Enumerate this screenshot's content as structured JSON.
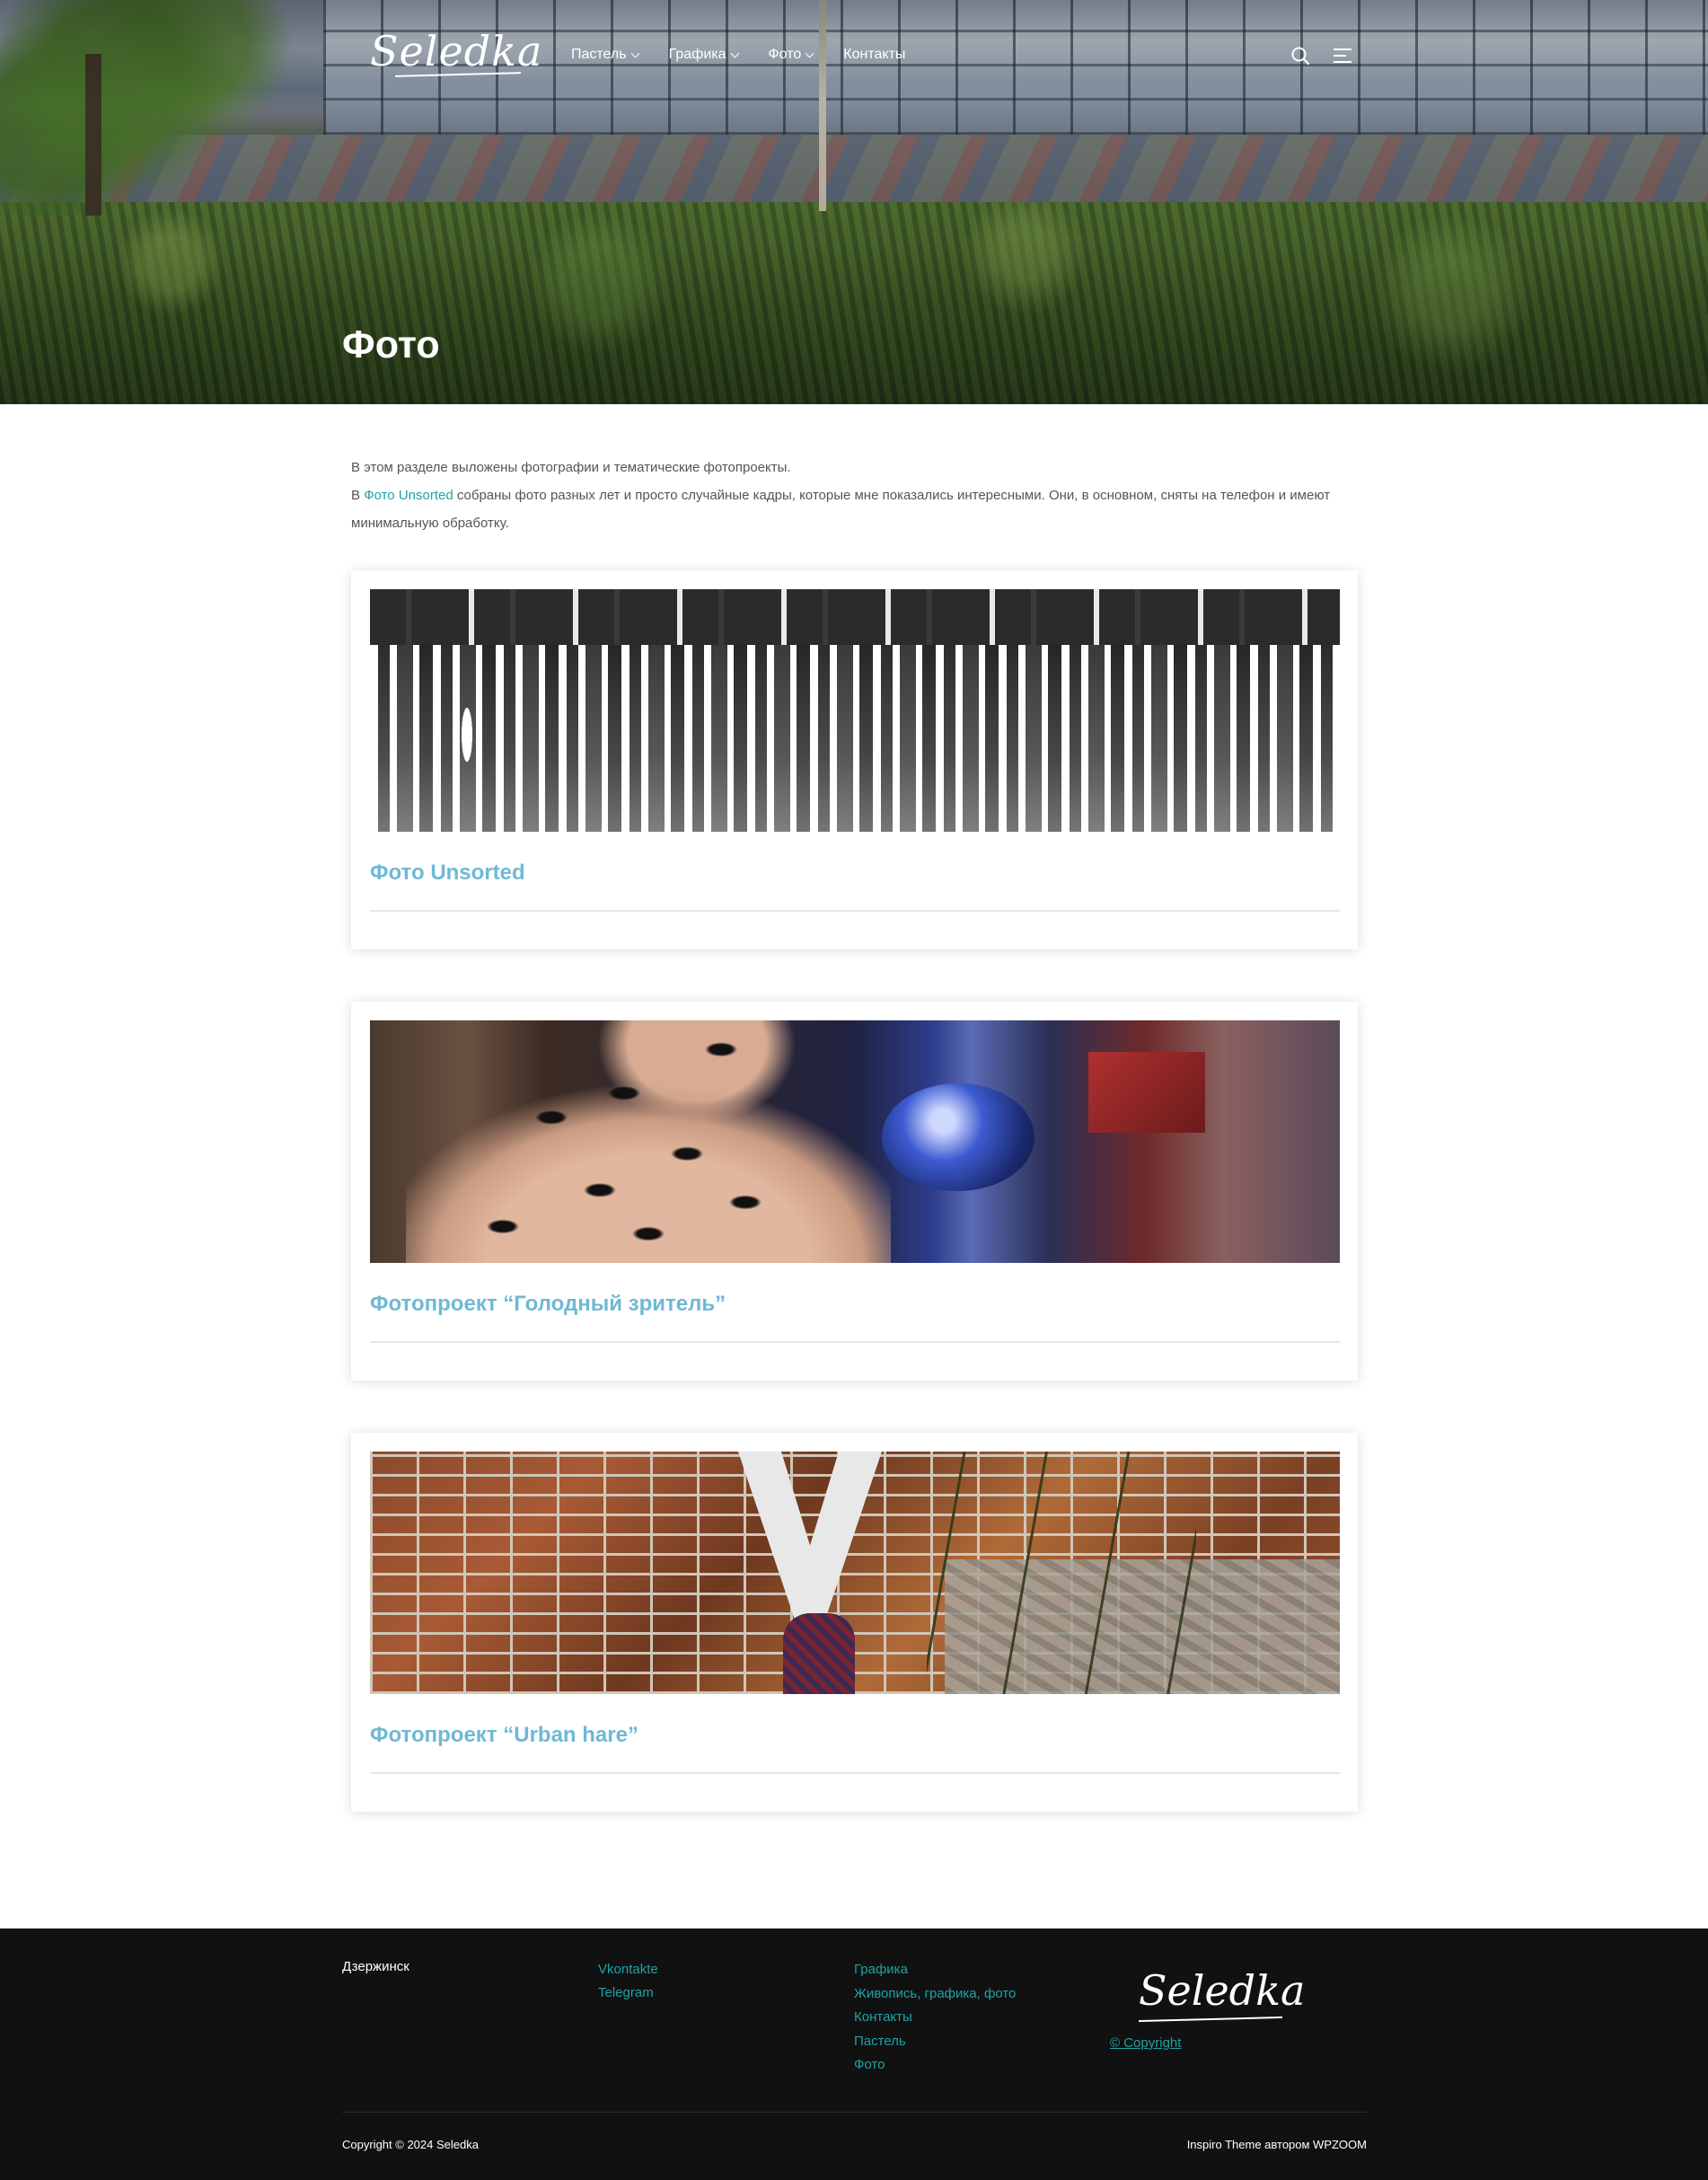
{
  "header": {
    "logo_text": "Seledka",
    "nav": [
      {
        "label": "Пастель",
        "has_dropdown": true
      },
      {
        "label": "Графика",
        "has_dropdown": true
      },
      {
        "label": "Фото",
        "has_dropdown": true
      },
      {
        "label": "Контакты",
        "has_dropdown": false
      }
    ],
    "icons": [
      "search-icon",
      "menu-icon"
    ]
  },
  "hero": {
    "title": "Фото"
  },
  "intro": {
    "line1": "В этом разделе выложены фотографии и тематические фотопроекты.",
    "line2_prefix": "В ",
    "line2_link": "Фото Unsorted",
    "line2_suffix": " собраны фото разных лет и просто случайные кадры, которые мне показались интересными. Они, в основном, сняты на телефон и имеют минимальную обработку."
  },
  "cards": [
    {
      "title": "Фото Unsorted"
    },
    {
      "title": "Фотопроект “Голодный зритель”"
    },
    {
      "title": "Фотопроект “Urban hare”"
    }
  ],
  "footer": {
    "city": "Дзержинск",
    "social": [
      "Vkontakte",
      "Telegram"
    ],
    "menu": [
      "Графика",
      "Живопись, графика, фото",
      "Контакты",
      "Пастель",
      "Фото"
    ],
    "logo_text": "Seledka",
    "copyright_link": "© Copyright",
    "copyright": "Copyright © 2024 Seledka",
    "theme_credit": "Inspiro Theme автором WPZOOM"
  },
  "colors": {
    "link": "#1ea3a3",
    "card_title": "#6fb8d6",
    "footer_bg": "#111111"
  }
}
